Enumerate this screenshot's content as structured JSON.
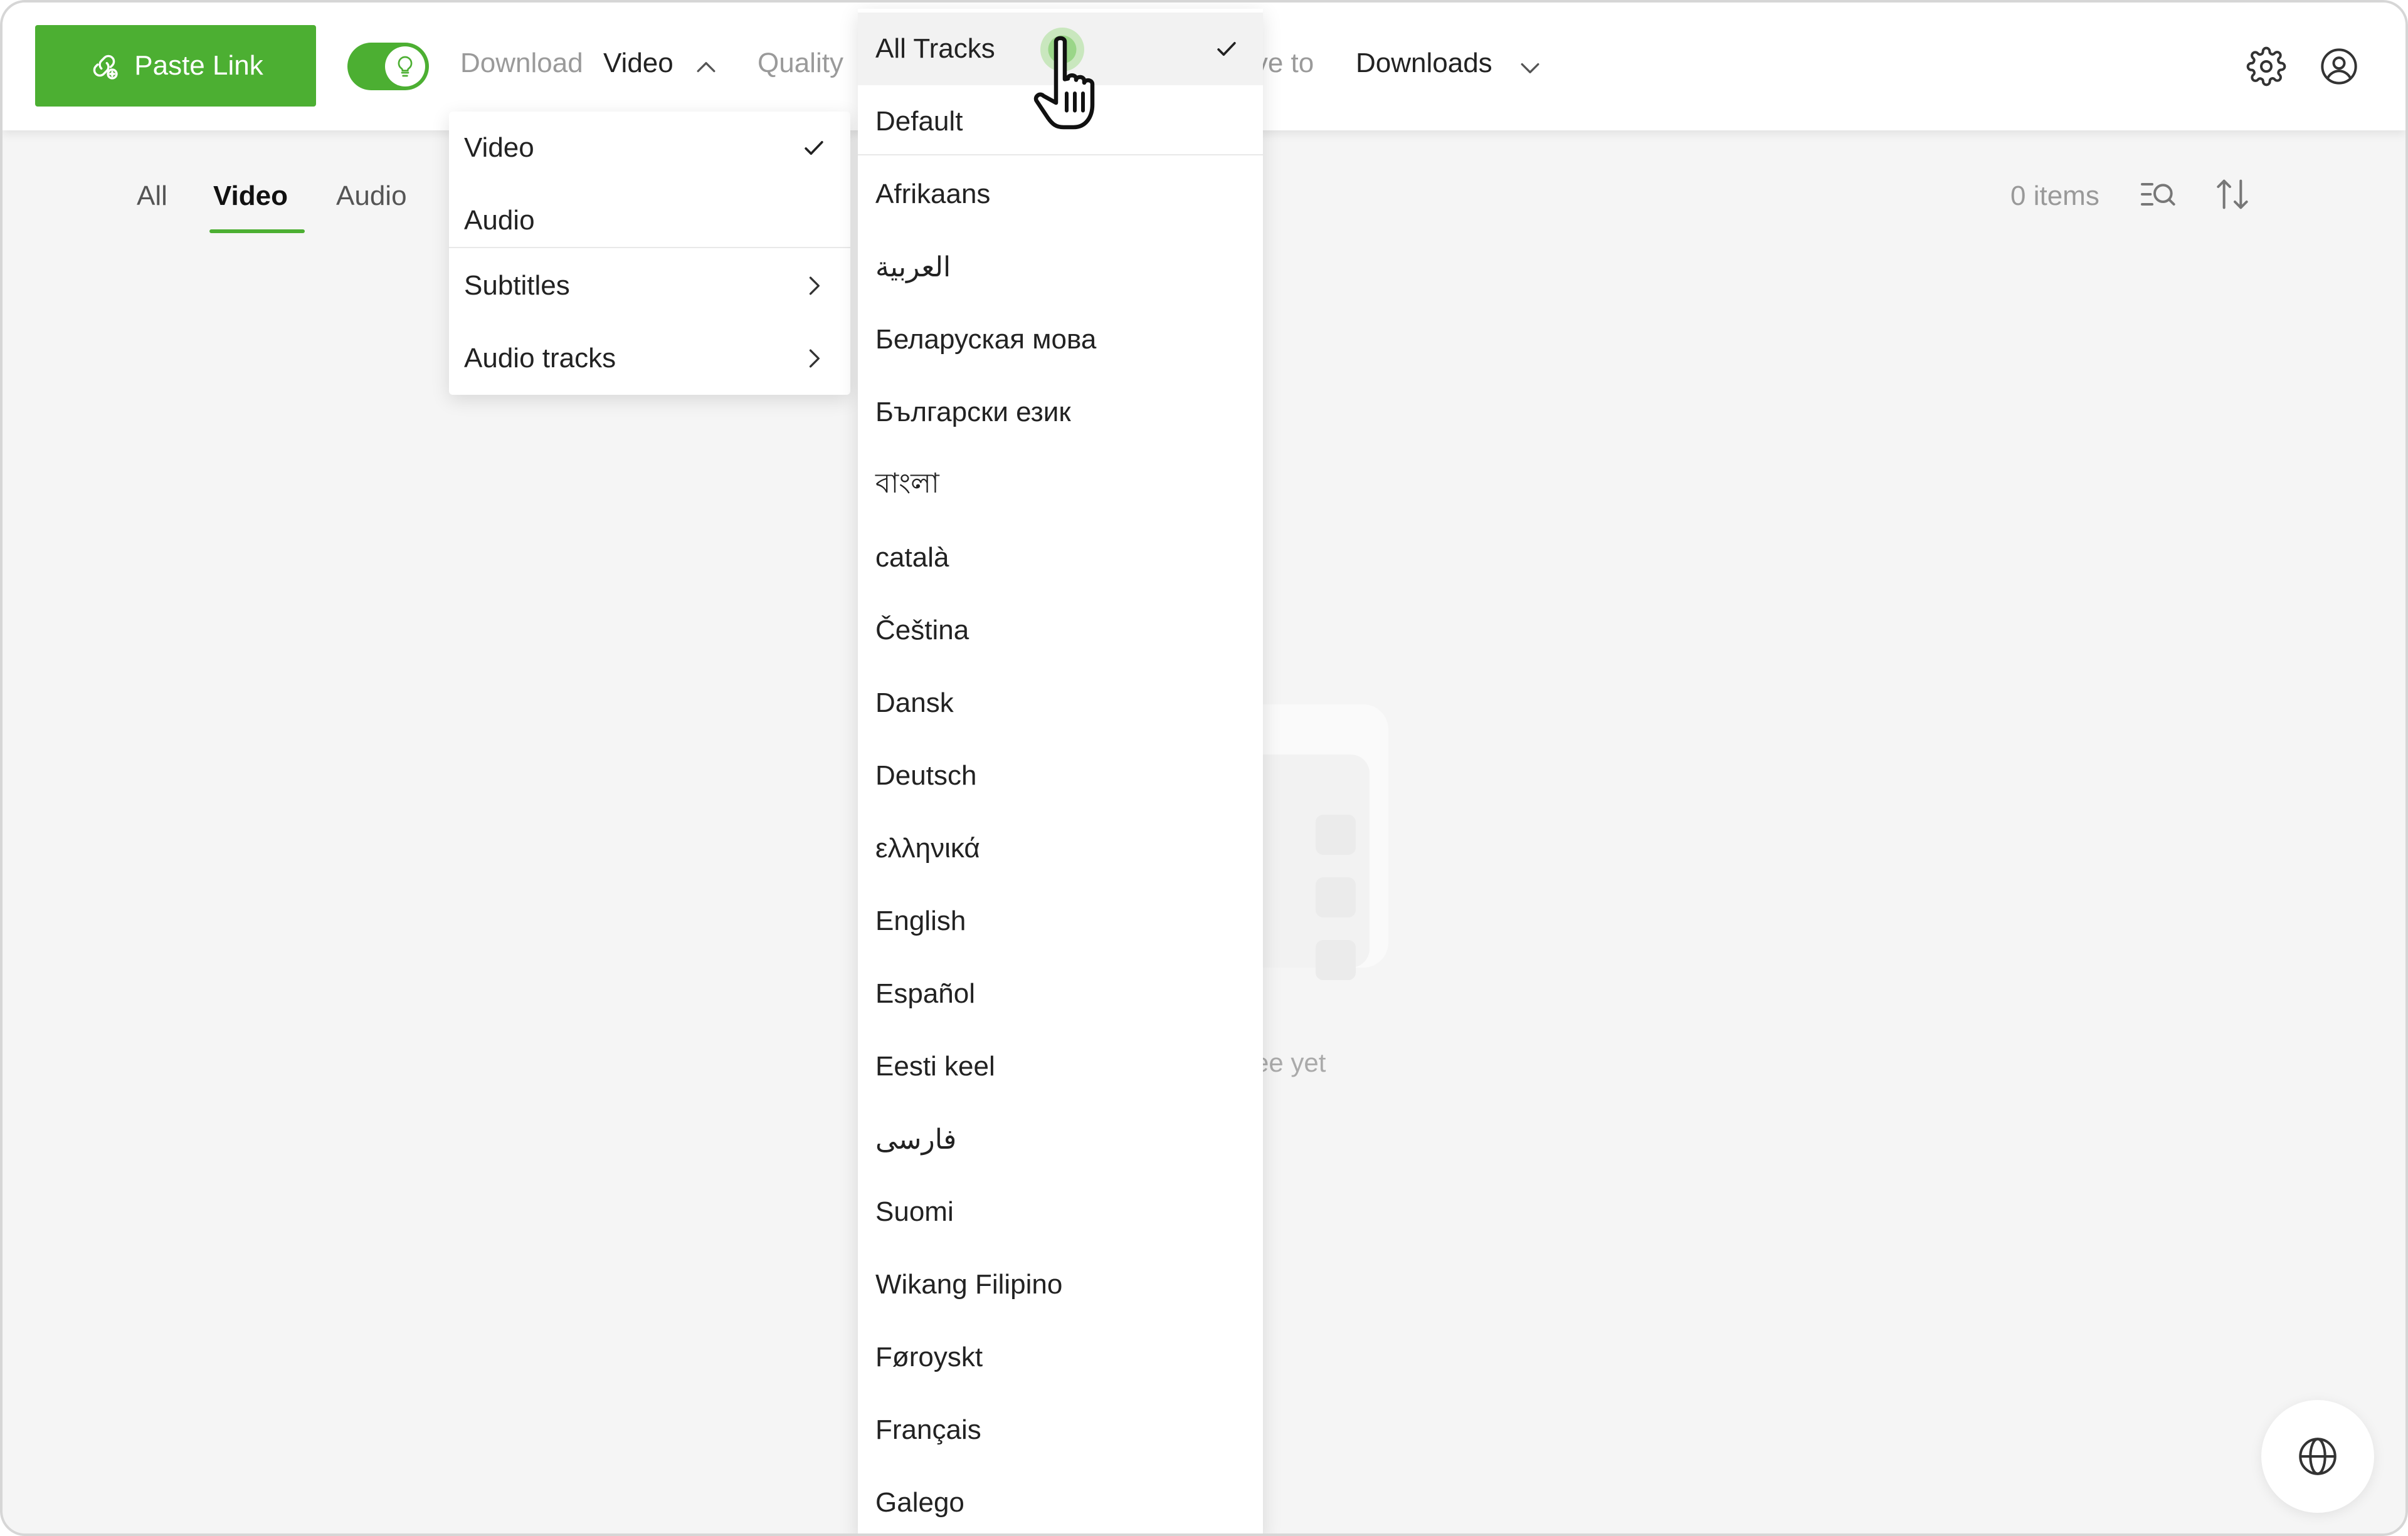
{
  "toolbar": {
    "paste_link_label": "Paste Link",
    "download_label": "Download",
    "download_value": "Video",
    "quality_label": "Quality",
    "save_to_label": "Save to",
    "save_to_value": "Downloads"
  },
  "tabs": [
    {
      "label": "All"
    },
    {
      "label": "Video",
      "active": true
    },
    {
      "label": "Audio"
    }
  ],
  "items_count": "0 items",
  "empty_state_text": "ee yet",
  "download_menu": {
    "items": [
      {
        "label": "Video",
        "checked": true
      },
      {
        "label": "Audio"
      },
      {
        "label": "Subtitles",
        "submenu": true
      },
      {
        "label": "Audio tracks",
        "submenu": true
      }
    ]
  },
  "audio_tracks_menu": {
    "items": [
      {
        "label": "All Tracks",
        "checked": true
      },
      {
        "label": "Default"
      },
      {
        "label": "Afrikaans"
      },
      {
        "label": "العربية"
      },
      {
        "label": "Беларуская мова"
      },
      {
        "label": "Български език"
      },
      {
        "label": "বাংলা"
      },
      {
        "label": "català"
      },
      {
        "label": "Čeština"
      },
      {
        "label": "Dansk"
      },
      {
        "label": "Deutsch"
      },
      {
        "label": "ελληνικά"
      },
      {
        "label": "English"
      },
      {
        "label": "Español"
      },
      {
        "label": "Eesti keel"
      },
      {
        "label": "فارسی"
      },
      {
        "label": "Suomi"
      },
      {
        "label": "Wikang Filipino"
      },
      {
        "label": "Føroyskt"
      },
      {
        "label": "Français"
      },
      {
        "label": "Galego"
      }
    ]
  },
  "colors": {
    "accent": "#4caf32",
    "background": "#f5f5f5"
  }
}
